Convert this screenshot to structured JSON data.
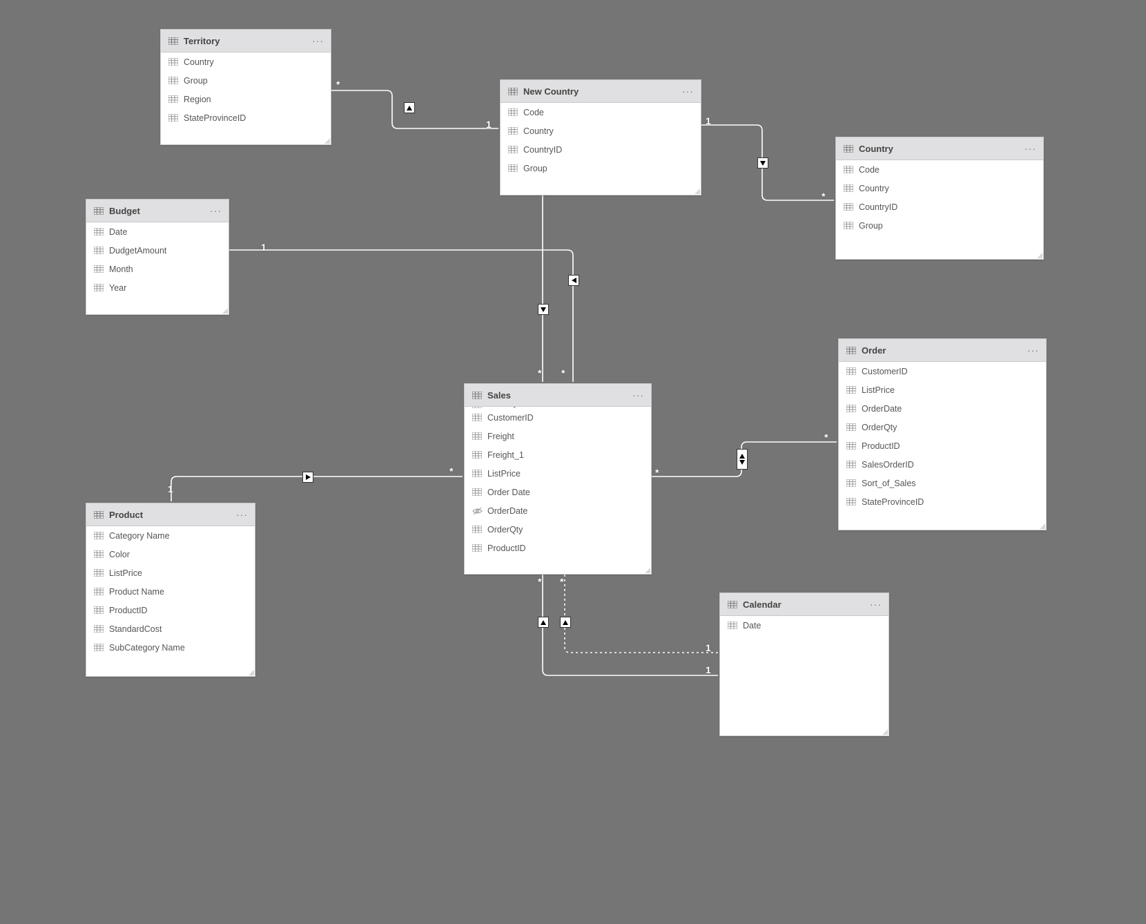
{
  "more_glyph": "···",
  "tables": {
    "territory": {
      "title": "Territory",
      "columns": [
        "Country",
        "Group",
        "Region",
        "StateProvinceID"
      ]
    },
    "budget": {
      "title": "Budget",
      "columns": [
        "Date",
        "DudgetAmount",
        "Month",
        "Year"
      ]
    },
    "newcountry": {
      "title": "New Country",
      "columns": [
        "Code",
        "Country",
        "CountryID",
        "Group"
      ]
    },
    "country": {
      "title": "Country",
      "columns": [
        "Code",
        "Country",
        "CountryID",
        "Group"
      ]
    },
    "sales": {
      "title": "Sales",
      "columns_clipped_top": "CountryID",
      "columns": [
        "CustomerID",
        "Freight",
        "Freight_1",
        "ListPrice",
        "Order Date",
        "OrderDate",
        "OrderQty",
        "ProductID"
      ],
      "hidden_columns": [
        "OrderDate"
      ]
    },
    "order": {
      "title": "Order",
      "columns": [
        "CustomerID",
        "ListPrice",
        "OrderDate",
        "OrderQty",
        "ProductID",
        "SalesOrderID",
        "Sort_of_Sales",
        "StateProvinceID"
      ]
    },
    "product": {
      "title": "Product",
      "columns": [
        "Category Name",
        "Color",
        "ListPrice",
        "Product Name",
        "ProductID",
        "StandardCost",
        "SubCategory Name"
      ]
    },
    "calendar": {
      "title": "Calendar",
      "columns": [
        "Date"
      ]
    }
  },
  "relationships": [
    {
      "from": "territory",
      "to": "newcountry",
      "from_card": "*",
      "to_card": "1",
      "direction": "right",
      "style": "solid"
    },
    {
      "from": "newcountry",
      "to": "country",
      "from_card": "1",
      "to_card": "*",
      "direction": "down",
      "style": "solid"
    },
    {
      "from": "newcountry",
      "to": "sales",
      "from_card": "1",
      "to_card": "*",
      "direction": "down",
      "style": "solid",
      "filter_dir": "left"
    },
    {
      "from": "budget",
      "to": "sales",
      "from_card": "1",
      "to_card": "*",
      "direction": "down",
      "style": "solid"
    },
    {
      "from": "product",
      "to": "sales",
      "from_card": "1",
      "to_card": "*",
      "direction": "right",
      "style": "solid"
    },
    {
      "from": "order",
      "to": "sales",
      "from_card": "*",
      "to_card": "*",
      "direction": "both",
      "style": "solid"
    },
    {
      "from": "calendar",
      "to": "sales",
      "from_card": "1",
      "to_card": "*",
      "direction": "up",
      "style": "solid"
    },
    {
      "from": "calendar",
      "to": "sales",
      "from_card": "1",
      "to_card": "*",
      "direction": "up",
      "style": "dashed"
    }
  ],
  "cardinality_labels": {
    "star": "*",
    "one": "1"
  }
}
